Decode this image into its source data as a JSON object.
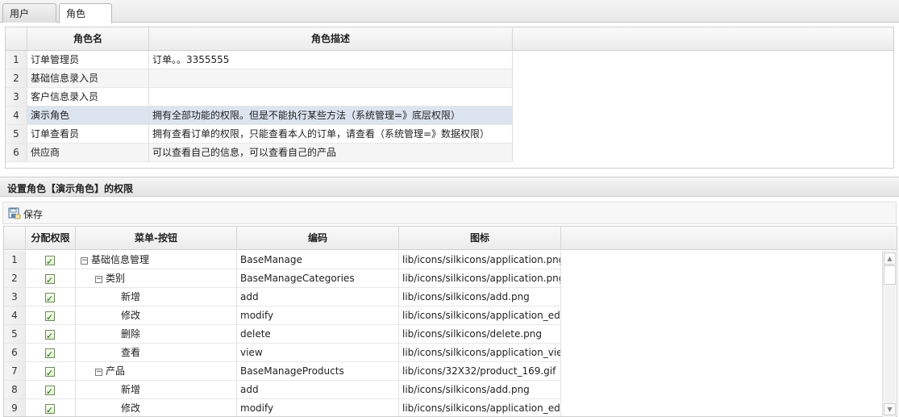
{
  "tabs": [
    {
      "label": "用户"
    },
    {
      "label": "角色"
    }
  ],
  "roles_grid": {
    "headers": {
      "name": "角色名",
      "desc": "角色描述"
    },
    "rows": [
      {
        "num": "1",
        "name": "订单管理员",
        "desc": "订单。。3355555"
      },
      {
        "num": "2",
        "name": "基础信息录入员",
        "desc": ""
      },
      {
        "num": "3",
        "name": "客户信息录入员",
        "desc": ""
      },
      {
        "num": "4",
        "name": "演示角色",
        "desc": "拥有全部功能的权限。但是不能执行某些方法（系统管理=》底层权限）"
      },
      {
        "num": "5",
        "name": "订单查看员",
        "desc": "拥有查看订单的权限，只能查看本人的订单，请查看（系统管理=》数据权限）"
      },
      {
        "num": "6",
        "name": "供应商",
        "desc": "可以查看自己的信息，可以查看自己的产品"
      }
    ]
  },
  "perm_panel": {
    "title": "设置角色【演示角色】的权限",
    "save_label": "保存",
    "headers": {
      "assign": "分配权限",
      "menu": "菜单-按钮",
      "code": "编码",
      "icon": "图标"
    },
    "rows": [
      {
        "num": "1",
        "menu": "基础信息管理",
        "code": "BaseManage",
        "icon": "lib/icons/silkicons/application.png"
      },
      {
        "num": "2",
        "menu": "类别",
        "code": "BaseManageCategories",
        "icon": "lib/icons/silkicons/application.png"
      },
      {
        "num": "3",
        "menu": "新增",
        "code": "add",
        "icon": "lib/icons/silkicons/add.png"
      },
      {
        "num": "4",
        "menu": "修改",
        "code": "modify",
        "icon": "lib/icons/silkicons/application_ed"
      },
      {
        "num": "5",
        "menu": "删除",
        "code": "delete",
        "icon": "lib/icons/silkicons/delete.png"
      },
      {
        "num": "6",
        "menu": "查看",
        "code": "view",
        "icon": "lib/icons/silkicons/application_vie"
      },
      {
        "num": "7",
        "menu": "产品",
        "code": "BaseManageProducts",
        "icon": "lib/icons/32X32/product_169.gif"
      },
      {
        "num": "8",
        "menu": "新增",
        "code": "add",
        "icon": "lib/icons/silkicons/add.png"
      },
      {
        "num": "9",
        "menu": "修改",
        "code": "modify",
        "icon": "lib/icons/silkicons/application_ed"
      }
    ]
  }
}
